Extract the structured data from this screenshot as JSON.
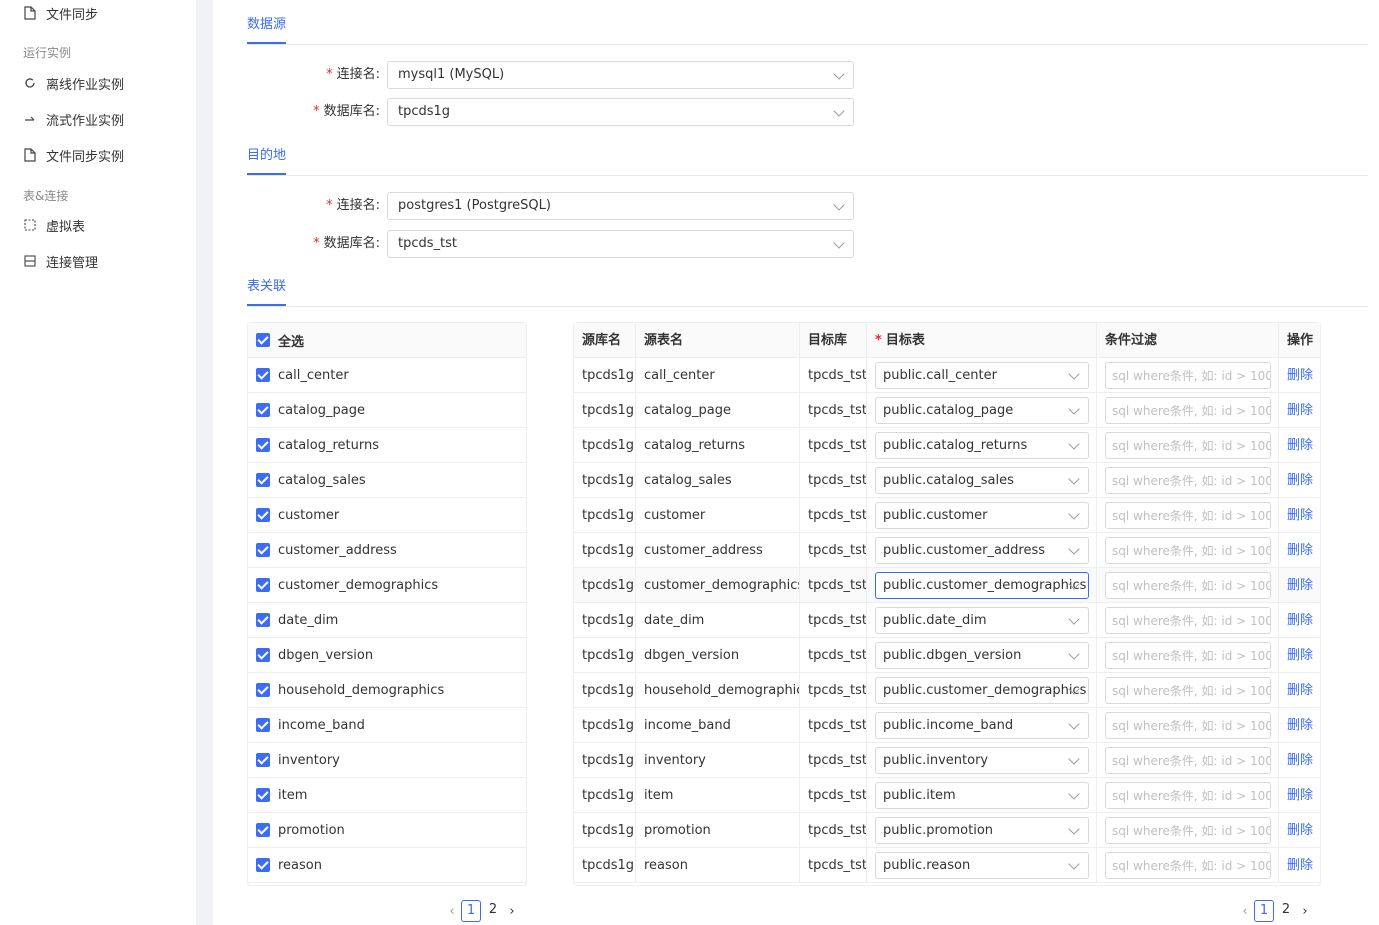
{
  "sidebar": {
    "items_top": [
      {
        "label": "文件同步",
        "icon": "file-icon"
      }
    ],
    "groups": [
      {
        "title": "运行实例",
        "items": [
          {
            "label": "离线作业实例",
            "icon": "refresh-icon"
          },
          {
            "label": "流式作业实例",
            "icon": "arrow-right-icon"
          },
          {
            "label": "文件同步实例",
            "icon": "file-icon"
          }
        ]
      },
      {
        "title": "表&连接",
        "items": [
          {
            "label": "虚拟表",
            "icon": "dashed-box-icon"
          },
          {
            "label": "连接管理",
            "icon": "list-icon"
          }
        ]
      }
    ]
  },
  "source": {
    "title": "数据源",
    "conn_label": "连接名",
    "conn_value": "mysql1 (MySQL)",
    "db_label": "数据库名",
    "db_value": "tpcds1g"
  },
  "target": {
    "title": "目的地",
    "conn_label": "连接名",
    "conn_value": "postgres1 (PostgreSQL)",
    "db_label": "数据库名",
    "db_value": "tpcds_tst"
  },
  "mapping": {
    "title": "表关联",
    "select_all": "全选",
    "left_rows": [
      "call_center",
      "catalog_page",
      "catalog_returns",
      "catalog_sales",
      "customer",
      "customer_address",
      "customer_demographics",
      "date_dim",
      "dbgen_version",
      "household_demographics",
      "income_band",
      "inventory",
      "item",
      "promotion",
      "reason"
    ],
    "columns": [
      "源库名",
      "源表名",
      "目标库",
      "目标表",
      "条件过滤",
      "操作"
    ],
    "filter_placeholder": "sql where条件, 如: id > 100",
    "delete_label": "删除",
    "rows": [
      {
        "src_db": "tpcds1g",
        "src_table": "call_center",
        "dst_db": "tpcds_tst",
        "dst_table": "public.call_center"
      },
      {
        "src_db": "tpcds1g",
        "src_table": "catalog_page",
        "dst_db": "tpcds_tst",
        "dst_table": "public.catalog_page"
      },
      {
        "src_db": "tpcds1g",
        "src_table": "catalog_returns",
        "dst_db": "tpcds_tst",
        "dst_table": "public.catalog_returns"
      },
      {
        "src_db": "tpcds1g",
        "src_table": "catalog_sales",
        "dst_db": "tpcds_tst",
        "dst_table": "public.catalog_sales"
      },
      {
        "src_db": "tpcds1g",
        "src_table": "customer",
        "dst_db": "tpcds_tst",
        "dst_table": "public.customer"
      },
      {
        "src_db": "tpcds1g",
        "src_table": "customer_address",
        "dst_db": "tpcds_tst",
        "dst_table": "public.customer_address"
      },
      {
        "src_db": "tpcds1g",
        "src_table": "customer_demographics",
        "dst_db": "tpcds_tst",
        "dst_table": "public.customer_demographics",
        "focused": true
      },
      {
        "src_db": "tpcds1g",
        "src_table": "date_dim",
        "dst_db": "tpcds_tst",
        "dst_table": "public.date_dim"
      },
      {
        "src_db": "tpcds1g",
        "src_table": "dbgen_version",
        "dst_db": "tpcds_tst",
        "dst_table": "public.dbgen_version"
      },
      {
        "src_db": "tpcds1g",
        "src_table": "household_demographics",
        "dst_db": "tpcds_tst",
        "dst_table": "public.customer_demographics"
      },
      {
        "src_db": "tpcds1g",
        "src_table": "income_band",
        "dst_db": "tpcds_tst",
        "dst_table": "public.income_band"
      },
      {
        "src_db": "tpcds1g",
        "src_table": "inventory",
        "dst_db": "tpcds_tst",
        "dst_table": "public.inventory"
      },
      {
        "src_db": "tpcds1g",
        "src_table": "item",
        "dst_db": "tpcds_tst",
        "dst_table": "public.item"
      },
      {
        "src_db": "tpcds1g",
        "src_table": "promotion",
        "dst_db": "tpcds_tst",
        "dst_table": "public.promotion"
      },
      {
        "src_db": "tpcds1g",
        "src_table": "reason",
        "dst_db": "tpcds_tst",
        "dst_table": "public.reason"
      }
    ],
    "pagination_left": {
      "pages": [
        "1",
        "2"
      ],
      "current": "1"
    },
    "pagination_right": {
      "pages": [
        "1",
        "2"
      ],
      "current": "1"
    }
  },
  "colors": {
    "accent": "#3a6cf4",
    "required": "#f5222d",
    "border": "#eceef2"
  }
}
